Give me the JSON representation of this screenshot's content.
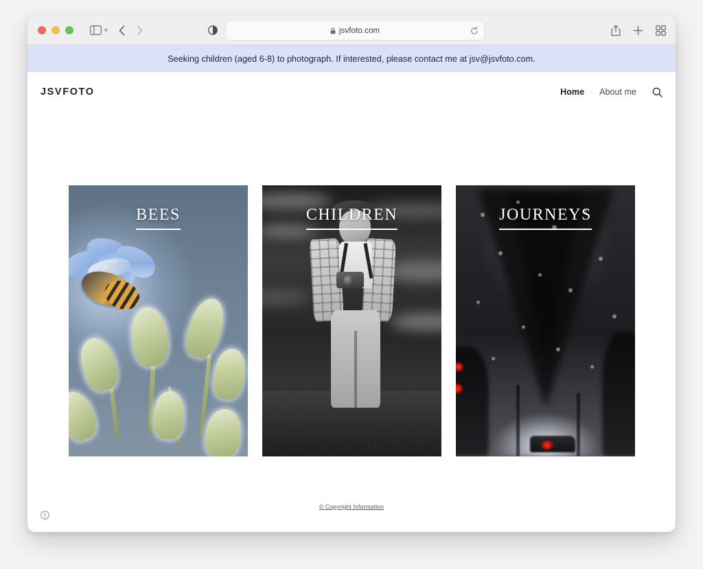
{
  "browser": {
    "url": "jsvfoto.com",
    "traffic_lights": [
      "close",
      "minimize",
      "zoom"
    ],
    "icons": {
      "sidebar": "sidebar-icon",
      "sidebar_chevron": "chevron-down-icon",
      "back": "chevron-left-icon",
      "forward": "chevron-right-icon",
      "reader": "contrast-shield-icon",
      "lock": "lock-icon",
      "reload": "reload-icon",
      "share": "share-icon",
      "new_tab": "plus-icon",
      "tab_overview": "grid-icon"
    }
  },
  "notice": {
    "text": "Seeking children (aged 6-8) to photograph. If interested, please contact me at jsv@jsvfoto.com.",
    "background": "#dbe2f8"
  },
  "header": {
    "logo": "JSVFOTO",
    "nav": {
      "home": "Home",
      "separator": "·",
      "about": "About me",
      "search_icon": "search-icon"
    }
  },
  "gallery": {
    "cards": [
      {
        "title": "Bees",
        "photo": "bee-on-blue-borage-flower"
      },
      {
        "title": "Children",
        "photo": "boy-with-camera-black-and-white"
      },
      {
        "title": "Journeys",
        "photo": "rainy-eiffel-tower-at-night"
      }
    ]
  },
  "footer": {
    "copyright": "© Copyright Information"
  },
  "page_info": {
    "icon": "info-circle-icon"
  }
}
